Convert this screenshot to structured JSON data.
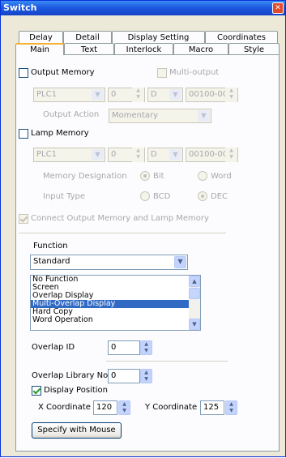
{
  "window": {
    "title": "Switch",
    "close_glyph": "✕"
  },
  "tabs_row1": [
    "Delay",
    "Detail",
    "Display Setting",
    "Coordinates"
  ],
  "tabs_row2": [
    "Main",
    "Text",
    "Interlock",
    "Macro",
    "Style"
  ],
  "output_memory": {
    "label": "Output Memory",
    "multi_output_label": "Multi-output",
    "plc": "PLC1",
    "station": "0",
    "device": "D",
    "address": "00100-00",
    "action_label": "Output Action",
    "action_value": "Momentary"
  },
  "lamp_memory": {
    "label": "Lamp Memory",
    "plc": "PLC1",
    "station": "0",
    "device": "D",
    "address": "00100-00",
    "designation_label": "Memory Designation",
    "bit_label": "Bit",
    "word_label": "Word",
    "input_type_label": "Input Type",
    "bcd_label": "BCD",
    "dec_label": "DEC"
  },
  "connect_label": "Connect Output Memory and Lamp Memory",
  "function": {
    "label": "Function",
    "selected": "Standard",
    "items": [
      "No Function",
      "Screen",
      "Overlap Display",
      "Multi-Overlap Display",
      "Hard Copy",
      "Word Operation"
    ],
    "selected_item": "Multi-Overlap Display"
  },
  "overlap_id": {
    "label": "Overlap ID",
    "value": "0"
  },
  "overlap_library": {
    "label": "Overlap Library No.",
    "value": "0"
  },
  "display_position": {
    "label": "Display Position",
    "x_label": "X Coordinate",
    "x_value": "120",
    "y_label": "Y Coordinate",
    "y_value": "125"
  },
  "specify_button": "Specify with Mouse",
  "icons": {
    "dropdown": "▼",
    "spin_up": "▲",
    "spin_down": "▼"
  }
}
